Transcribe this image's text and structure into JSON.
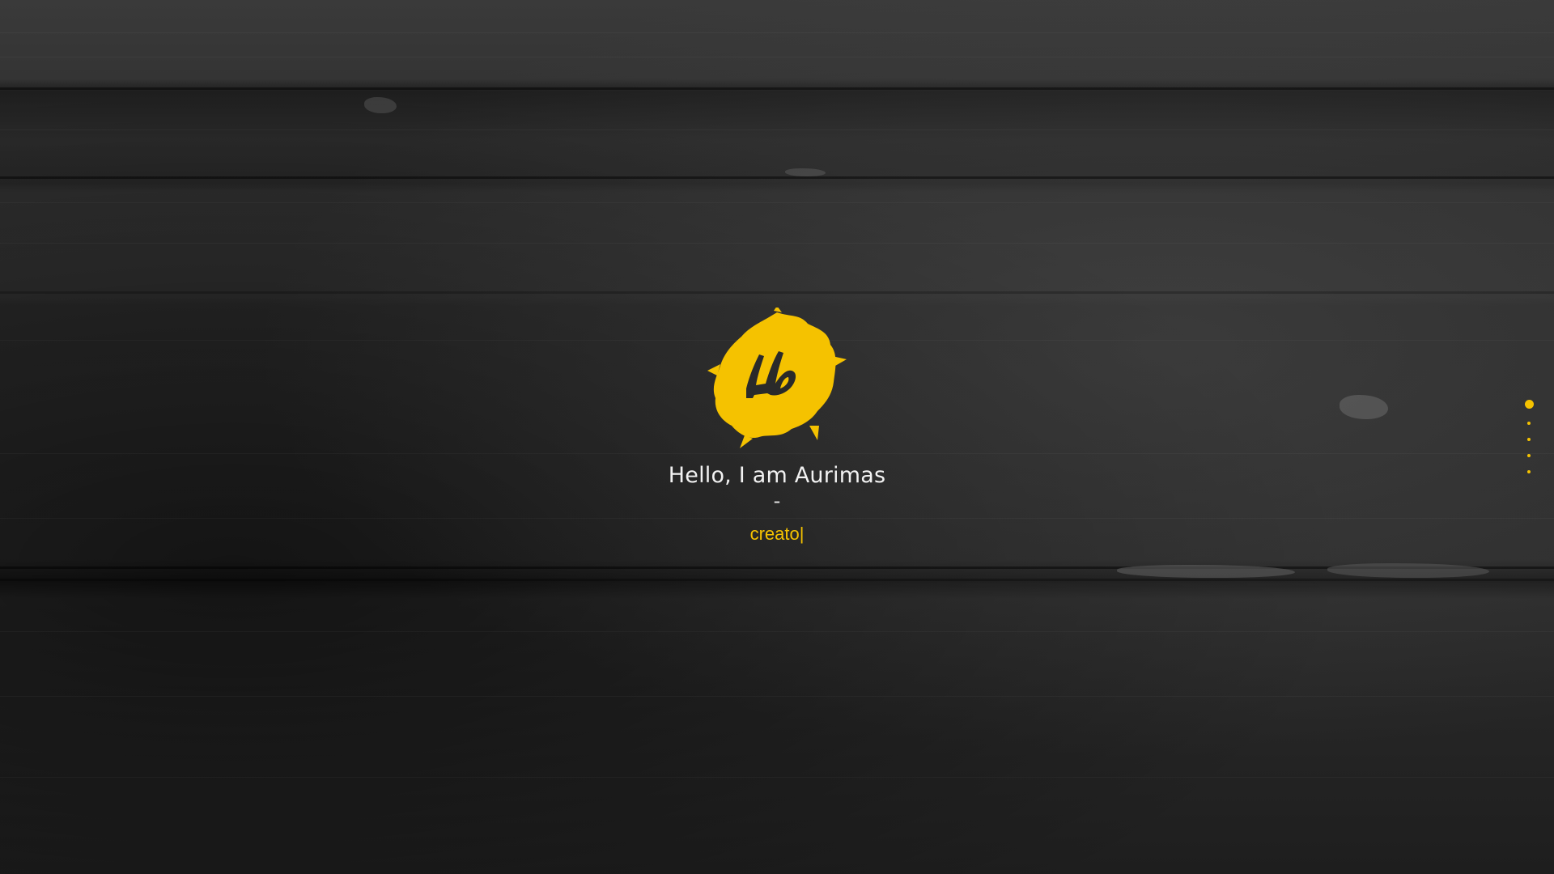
{
  "hero": {
    "greeting": "Hello, I am Aurimas",
    "separator": "-",
    "role_text": "creato",
    "caret": "|"
  },
  "logo": {
    "icon": "brush-stroke-logo-icon",
    "color": "#f5c200"
  },
  "nav_dots": {
    "count": 5,
    "active_index": 0,
    "color": "#f5c200"
  },
  "theme": {
    "accent": "#f5c200",
    "text": "#f2f2f2",
    "background": "#1f1f1f"
  }
}
